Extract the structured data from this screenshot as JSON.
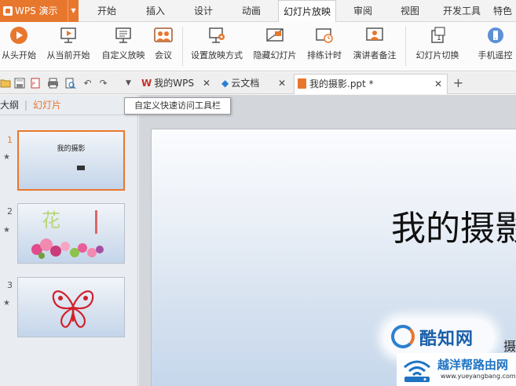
{
  "app": {
    "button_label": "WPS 演示"
  },
  "menu": {
    "tabs": [
      "开始",
      "插入",
      "设计",
      "动画",
      "幻灯片放映",
      "审阅",
      "视图",
      "开发工具",
      "特色"
    ],
    "active_tab": "幻灯片放映"
  },
  "ribbon": {
    "buttons": [
      {
        "label": "从头开始",
        "icon": "play-icon"
      },
      {
        "label": "从当前开始",
        "icon": "play-from-current-icon"
      },
      {
        "label": "自定义放映",
        "icon": "custom-show-icon"
      },
      {
        "label": "会议",
        "icon": "meeting-icon"
      },
      {
        "label": "设置放映方式",
        "icon": "setup-show-icon"
      },
      {
        "label": "隐藏幻灯片",
        "icon": "hide-slide-icon"
      },
      {
        "label": "排练计时",
        "icon": "rehearse-timing-icon"
      },
      {
        "label": "演讲者备注",
        "icon": "speaker-notes-icon"
      },
      {
        "label": "幻灯片切换",
        "icon": "slide-transition-icon"
      },
      {
        "label": "手机遥控",
        "icon": "phone-remote-icon"
      }
    ]
  },
  "doc_tabs": [
    {
      "label": "我的WPS",
      "icon": "wps-logo-icon"
    },
    {
      "label": "云文档",
      "icon": "cloud-doc-icon"
    },
    {
      "label": "我的摄影.ppt *",
      "icon": "ppt-file-icon",
      "active": true
    }
  ],
  "tooltip": {
    "text": "自定义快速访问工具栏"
  },
  "left_panel": {
    "tabs": [
      "大纲",
      "幻灯片"
    ],
    "active_tab": "幻灯片",
    "slides": [
      {
        "number": "1",
        "title": "我的摄影",
        "selected": true
      },
      {
        "number": "2",
        "title": "花"
      },
      {
        "number": "3"
      }
    ]
  },
  "slide": {
    "title": "我的摄影",
    "sub_fragment": "摄"
  },
  "watermarks": {
    "kuzhi": "酷知网",
    "router_title": "越洋帮路由网",
    "router_url": "www.yueyangbang.com"
  },
  "colors": {
    "accent": "#e8772e",
    "slide_bg": "#dde6f1",
    "panel_bg": "#e9ecf1"
  }
}
